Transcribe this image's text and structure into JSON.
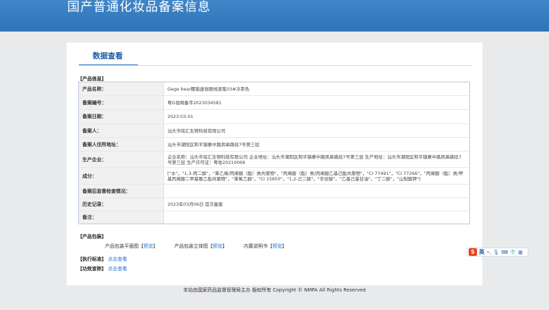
{
  "header": {
    "title": "国产普通化妆品备案信息"
  },
  "tab": {
    "label": "数据查看"
  },
  "product_info": {
    "section_label": "【产品信息】",
    "rows": [
      {
        "label": "产品名称：",
        "value": "Gege bear糯猫速妆眼线液笔03#冷茶色"
      },
      {
        "label": "备案编号：",
        "value": "粤G妆网备字2023034581"
      },
      {
        "label": "备案日期：",
        "value": "2023-03-01"
      },
      {
        "label": "备案人：",
        "value": "汕头市铭汇生物科技有限公司"
      },
      {
        "label": "备案人住所地址：",
        "value": "汕头市潮阳区和平镇寮中路凤皋路段7号第三层"
      },
      {
        "label": "生产企业：",
        "value": "企业名称：汕头市铭汇生物科技有限公司 企业地址：汕头市潮阳区和平镇寮中路凤皋路段7号第三层 生产地址：汕头市潮阳区和平镇寮中路凤皋路段7号第三层 生产许可证：粤妆20210068"
      },
      {
        "label": "成分：",
        "value": "[\"水\"，\"1,3-丙二醇\"，\"苯乙烯/丙烯酸（酯）类共聚物\"，\"丙烯酸（酯）类/丙烯酸乙基己酯共聚物\"，\"CI 77491\"，\"CI 77266\"，\"丙烯酸（酯）类/甲基丙烯酸二甲基氨乙酯共聚物\"，\"苯氧乙醇\"，\"CI 15850\"，\"1,2-己二醇\"，\"辛甘醇\"，\"乙基己基甘油\"，\"丁二醇\"，\"山梨酸钾\"]"
      },
      {
        "label": "备案后监督检查情况：",
        "value": ""
      },
      {
        "label": "历史记录：",
        "value": "2023年03月06日 首次备案"
      },
      {
        "label": "备注：",
        "value": ""
      }
    ]
  },
  "packaging": {
    "section_label": "【产品包装】",
    "items": [
      {
        "name": "产品包装平面图",
        "open": "【",
        "link": "预览",
        "close": "】"
      },
      {
        "name": "产品包装立体图",
        "open": "【",
        "link": "预览",
        "close": "】"
      },
      {
        "name": "内置说明书",
        "open": "【",
        "link": "预览",
        "close": "】"
      }
    ]
  },
  "standard": {
    "section_label": "【执行标准】",
    "link": "点击查看"
  },
  "efficacy": {
    "section_label": "【功效宣称】",
    "link": "点击查看"
  },
  "footer": {
    "text": "本站由国家药品监督管理局主办 版权所有 Copyright © NMPA All Rights Reserved"
  },
  "ime": {
    "lang": "英",
    "icons": [
      "dot-icon",
      "microphone-icon",
      "keyboard-icon",
      "clothing-icon",
      "grid-icon"
    ]
  },
  "colors": {
    "banner": "#2f73b8",
    "link": "#1e6fd0",
    "accent": "#1e5ea8"
  }
}
